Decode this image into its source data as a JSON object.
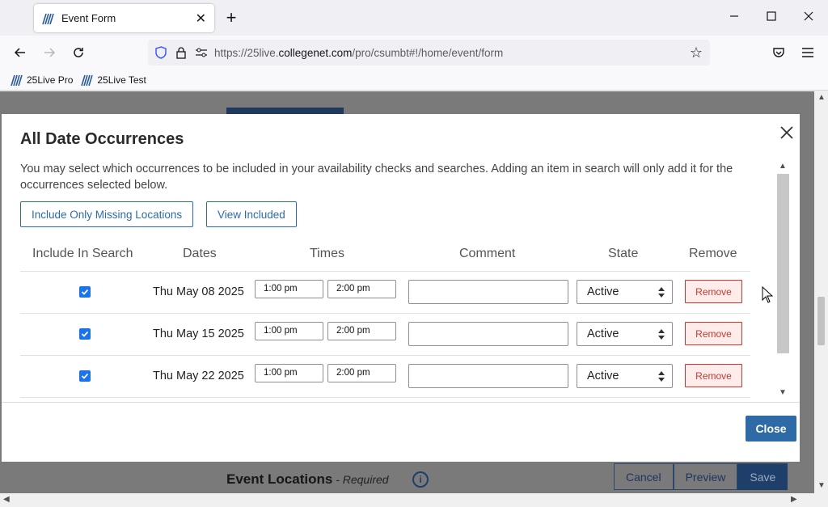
{
  "browser": {
    "tab_title": "Event Form",
    "tab_close": "✕",
    "new_tab": "+",
    "url_prefix": "https://25live.",
    "url_domain": "collegenet.com",
    "url_path": "/pro/csumbt#!/home/event/form",
    "bookmarks": [
      "25Live Pro",
      "25Live Test"
    ]
  },
  "modal": {
    "title": "All Date Occurrences",
    "description": "You may select which occurrences to be included in your availability checks and searches. Adding an item in search will only add it for the occurrences selected below.",
    "include_missing_label": "Include Only Missing Locations",
    "view_included_label": "View Included",
    "columns": [
      "Include In Search",
      "Dates",
      "Times",
      "Comment",
      "State",
      "Remove"
    ],
    "rows": [
      {
        "checked": true,
        "date": "Thu May 08 2025",
        "start": "1:00 pm",
        "end": "2:00 pm",
        "comment": "",
        "state": "Active",
        "remove": "Remove"
      },
      {
        "checked": true,
        "date": "Thu May 15 2025",
        "start": "1:00 pm",
        "end": "2:00 pm",
        "comment": "",
        "state": "Active",
        "remove": "Remove"
      },
      {
        "checked": true,
        "date": "Thu May 22 2025",
        "start": "1:00 pm",
        "end": "2:00 pm",
        "comment": "",
        "state": "Active",
        "remove": "Remove"
      }
    ],
    "close_label": "Close"
  },
  "background": {
    "locations_title": "Event Locations",
    "locations_required": " - Required",
    "cancel_label": "Cancel",
    "preview_label": "Preview",
    "save_label": "Save"
  },
  "colors": {
    "accent": "#2e6ba6",
    "remove": "#c43a31",
    "checkbox": "#1a73e8"
  }
}
